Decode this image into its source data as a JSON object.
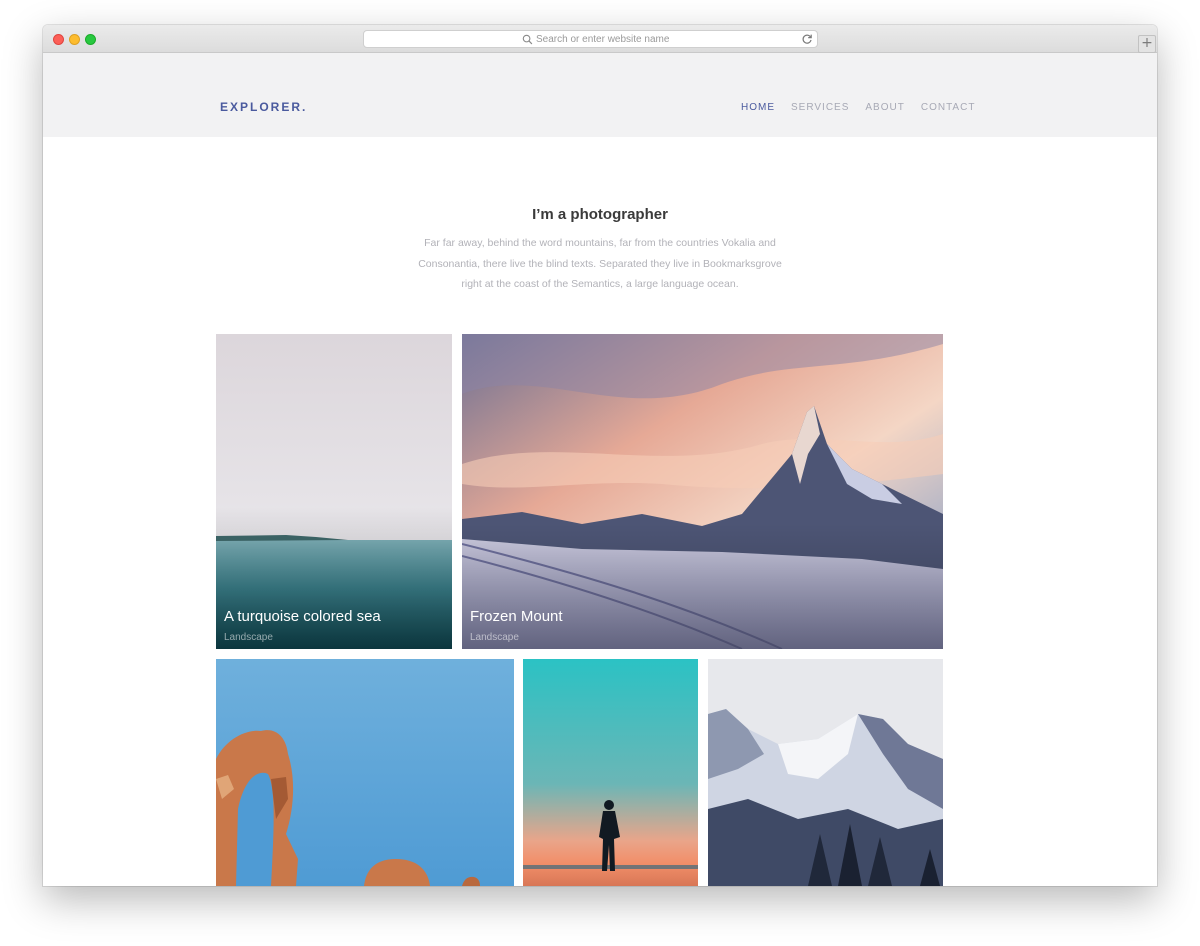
{
  "browser": {
    "address_placeholder": "Search or enter website name",
    "new_tab_glyph": "+"
  },
  "header": {
    "logo": "EXPLORER.",
    "nav": [
      {
        "label": "HOME"
      },
      {
        "label": "SERVICES"
      },
      {
        "label": "ABOUT"
      },
      {
        "label": "CONTACT"
      }
    ]
  },
  "hero": {
    "title": "I’m a photographer",
    "lines": [
      "Far far away, behind the word mountains, far from the countries Vokalia and",
      "Consonantia, there live the blind texts. Separated they live in Bookmarksgrove",
      "right at the coast of the Semantics, a large language ocean."
    ]
  },
  "gallery": [
    {
      "title": "A turquoise colored sea",
      "category": "Landscape"
    },
    {
      "title": "Frozen Mount",
      "category": "Landscape"
    },
    {
      "title": "",
      "category": ""
    },
    {
      "title": "",
      "category": ""
    },
    {
      "title": "",
      "category": ""
    }
  ],
  "colors": {
    "brand": "#4a5a9e",
    "nav_inactive": "#a7a9b5",
    "header_bg": "#f2f2f3"
  },
  "icons": [
    "search-icon",
    "reload-icon",
    "plus-icon"
  ]
}
